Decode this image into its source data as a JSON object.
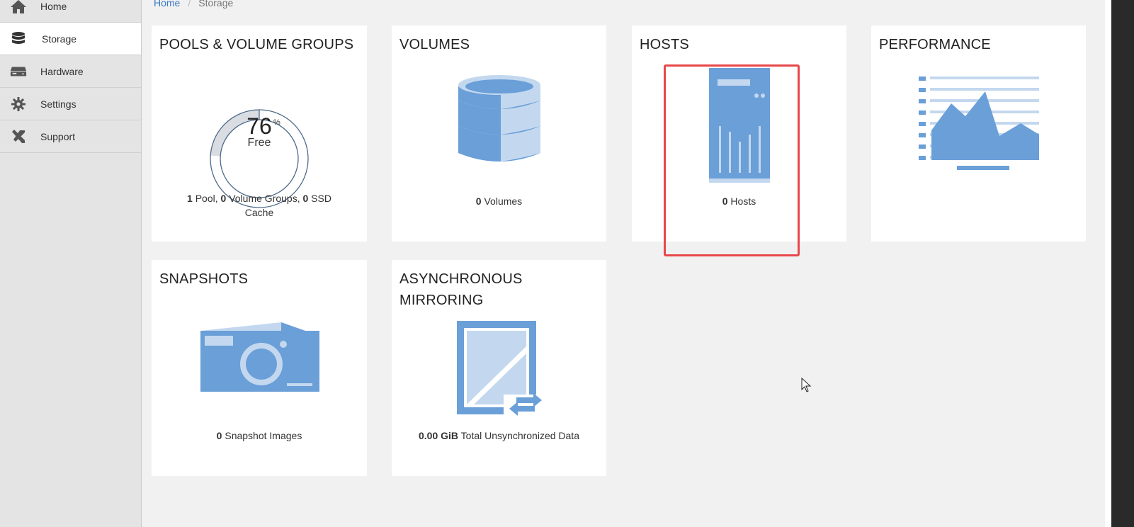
{
  "sidebar": {
    "items": [
      {
        "label": "Home",
        "icon": "home-icon",
        "active": false
      },
      {
        "label": "Storage",
        "icon": "database-icon",
        "active": true
      },
      {
        "label": "Hardware",
        "icon": "hardware-icon",
        "active": false
      },
      {
        "label": "Settings",
        "icon": "gear-icon",
        "active": false
      },
      {
        "label": "Support",
        "icon": "tools-icon",
        "active": false
      }
    ]
  },
  "breadcrumb": {
    "home": "Home",
    "separator": "/",
    "current": "Storage"
  },
  "tiles": {
    "pools": {
      "title": "POOLS & VOLUME GROUPS",
      "free_percent": "76",
      "percent_sign": "%",
      "free_label": "Free",
      "free_fraction": 0.76,
      "pool_count": "1",
      "pool_label": " Pool, ",
      "vg_count": "0",
      "vg_label": " Volume Groups, ",
      "ssd_count": "0",
      "ssd_label": " SSD Cache"
    },
    "volumes": {
      "title": "VOLUMES",
      "count": "0",
      "label": " Volumes"
    },
    "hosts": {
      "title": "HOSTS",
      "count": "0",
      "label": " Hosts"
    },
    "performance": {
      "title": "PERFORMANCE"
    },
    "snapshots": {
      "title": "SNAPSHOTS",
      "count": "0",
      "label": " Snapshot Images"
    },
    "mirroring": {
      "title": "ASYNCHRONOUS MIRRORING",
      "amount": "0.00 GiB",
      "label": " Total Unsynchronized Data"
    }
  },
  "colors": {
    "icon_blue": "#6a9fd8",
    "icon_light": "#c3d8ef",
    "highlight": "#e8474a",
    "link": "#3a7bc8"
  }
}
